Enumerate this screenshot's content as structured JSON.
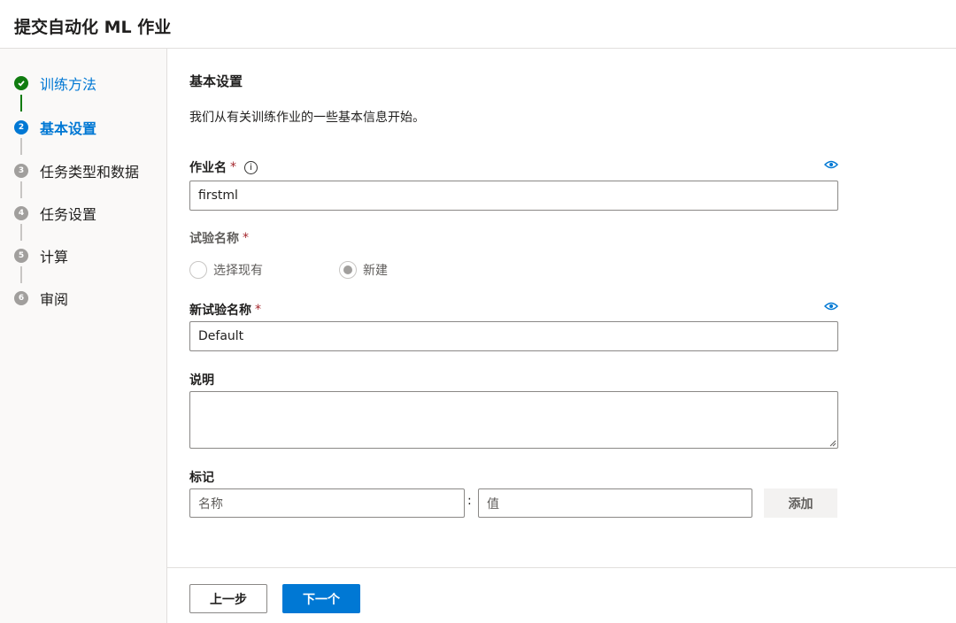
{
  "header": {
    "title": "提交自动化 ML 作业"
  },
  "steps": [
    {
      "index": "1",
      "label": "训练方法",
      "state": "done"
    },
    {
      "index": "2",
      "label": "基本设置",
      "state": "current"
    },
    {
      "index": "3",
      "label": "任务类型和数据",
      "state": "todo"
    },
    {
      "index": "4",
      "label": "任务设置",
      "state": "todo"
    },
    {
      "index": "5",
      "label": "计算",
      "state": "todo"
    },
    {
      "index": "6",
      "label": "审阅",
      "state": "todo"
    }
  ],
  "main": {
    "title": "基本设置",
    "description": "我们从有关训练作业的一些基本信息开始。",
    "job_name": {
      "label": "作业名",
      "required": "*",
      "value": "firstml"
    },
    "experiment": {
      "label": "试验名称",
      "required": "*",
      "options": [
        {
          "label": "选择现有",
          "selected": false
        },
        {
          "label": "新建",
          "selected": true
        }
      ]
    },
    "new_experiment": {
      "label": "新试验名称",
      "required": "*",
      "value": "Default"
    },
    "description_field": {
      "label": "说明",
      "value": ""
    },
    "tags": {
      "label": "标记",
      "name_placeholder": "名称",
      "separator": ":",
      "value_placeholder": "值",
      "add_label": "添加"
    }
  },
  "footer": {
    "prev_label": "上一步",
    "next_label": "下一个"
  },
  "colors": {
    "accent": "#0078d4",
    "success": "#107c10",
    "required": "#a4262c"
  }
}
